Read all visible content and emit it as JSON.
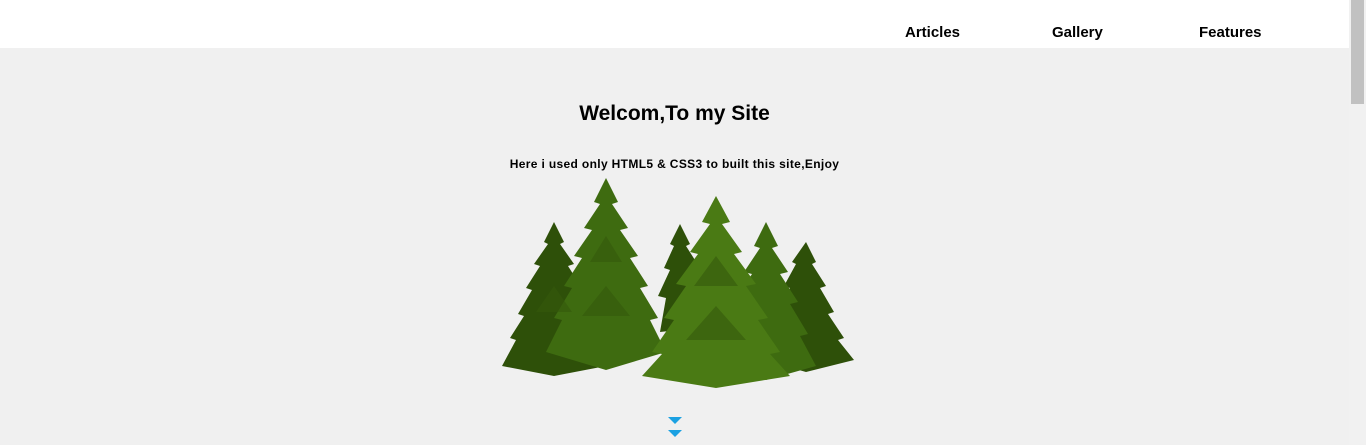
{
  "nav": {
    "items": [
      {
        "label": "Articles"
      },
      {
        "label": "Gallery"
      },
      {
        "label": "Features"
      }
    ]
  },
  "hero": {
    "title": "Welcom,To my Site",
    "subtitle": "Here i used only HTML5 & CSS3 to built this site,Enjoy",
    "image_icon": "pine-trees-illustration",
    "scroll_icon": "double-chevron-down-icon"
  },
  "colors": {
    "page_background": "#f0f0f0",
    "header_background": "#ffffff",
    "tree_dark": "#2e5009",
    "tree_mid": "#3e6b10",
    "tree_light": "#4a7a14",
    "accent_arrow": "#1ba1e2"
  }
}
